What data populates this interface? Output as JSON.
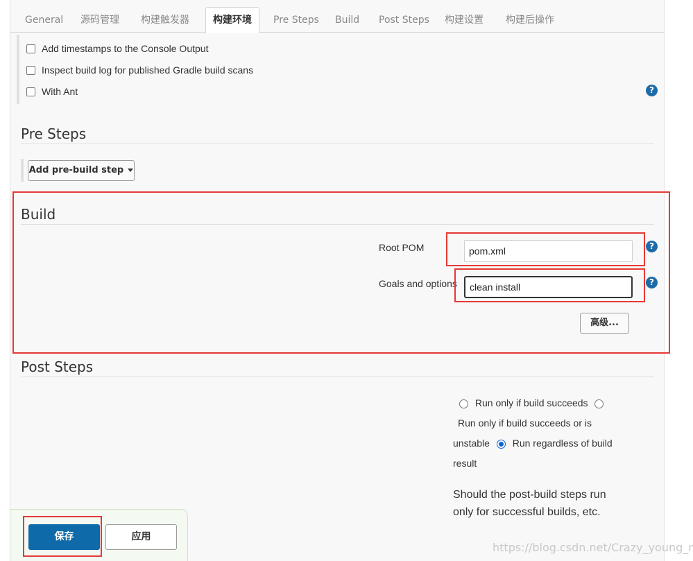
{
  "tabs": [
    {
      "label": "General"
    },
    {
      "label": "源码管理"
    },
    {
      "label": "构建触发器"
    },
    {
      "label": "构建环境"
    },
    {
      "label": "Pre Steps"
    },
    {
      "label": "Build"
    },
    {
      "label": "Post Steps"
    },
    {
      "label": "构建设置"
    },
    {
      "label": "构建后操作"
    }
  ],
  "active_tab": "构建环境",
  "build_env": {
    "options": [
      {
        "label": "Add timestamps to the Console Output",
        "checked": false
      },
      {
        "label": "Inspect build log for published Gradle build scans",
        "checked": false
      },
      {
        "label": "With Ant",
        "checked": false
      }
    ]
  },
  "pre_steps": {
    "title": "Pre Steps",
    "add_button": "Add pre-build step"
  },
  "build": {
    "title": "Build",
    "root_pom_label": "Root POM",
    "root_pom_value": "pom.xml",
    "goals_label": "Goals and options",
    "goals_value": "clean install",
    "advanced_button": "高级..."
  },
  "post_steps": {
    "title": "Post Steps",
    "radio_1": "Run only if build succeeds",
    "radio_2a": "Run only if build succeeds or is",
    "radio_2b": "unstable",
    "radio_3a": "Run regardless of build",
    "radio_3b": "result",
    "selected": "Run regardless of build result",
    "description": "Should the post-build steps run only for successful builds, etc."
  },
  "footer": {
    "save_label": "保存",
    "apply_label": "应用"
  },
  "watermark": "https://blog.csdn.net/Crazy_young_man",
  "colors": {
    "accent_blue": "#0e6aa9",
    "help_blue": "#1c6ba8",
    "annotation_red": "#e53935"
  },
  "icons": {
    "help": "question-mark-circle",
    "dropdown": "caret-down"
  }
}
